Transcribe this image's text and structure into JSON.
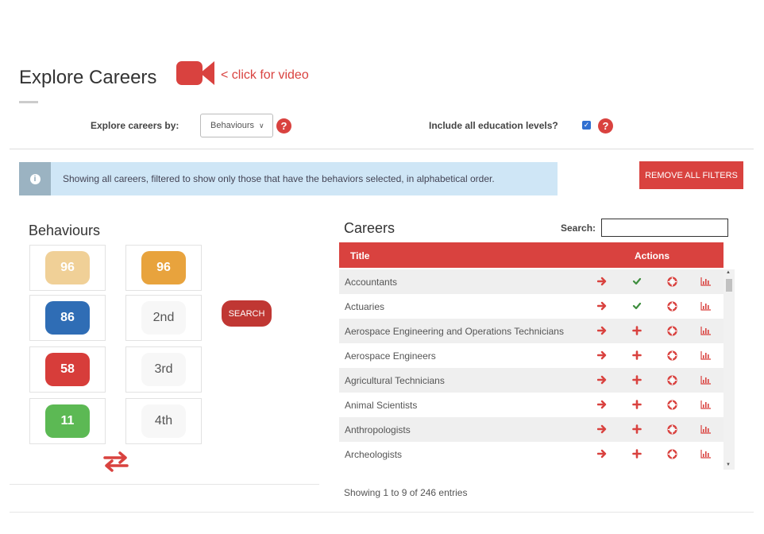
{
  "header": {
    "title": "Explore Careers",
    "video_link": "< click for video"
  },
  "controls": {
    "explore_by_label": "Explore careers by:",
    "explore_by_value": "Behaviours",
    "education_label": "Include all education levels?",
    "education_checked": true
  },
  "info": {
    "message": "Showing all careers, filtered to show only those that have the behaviors selected, in alphabetical order.",
    "remove_filters": "REMOVE ALL FILTERS"
  },
  "behaviours": {
    "heading": "Behaviours",
    "scores": [
      {
        "value": "96",
        "color": "#f0d097",
        "text_color": "#ffffff"
      },
      {
        "value": "86",
        "color": "#2f6db5",
        "text_color": "#ffffff"
      },
      {
        "value": "58",
        "color": "#d73d3a",
        "text_color": "#ffffff"
      },
      {
        "value": "11",
        "color": "#5cb954",
        "text_color": "#ffffff"
      }
    ],
    "ranks": [
      {
        "value": "96",
        "color": "#e8a33d",
        "text_color": "#ffffff"
      },
      {
        "value": "2nd"
      },
      {
        "value": "3rd"
      },
      {
        "value": "4th"
      }
    ],
    "search_button": "SEARCH"
  },
  "careers": {
    "heading": "Careers",
    "search_label": "Search:",
    "search_value": "",
    "columns": {
      "title": "Title",
      "actions": "Actions"
    },
    "rows": [
      {
        "title": "Accountants",
        "second": "check"
      },
      {
        "title": "Actuaries",
        "second": "check"
      },
      {
        "title": "Aerospace Engineering and Operations Technicians",
        "second": "plus"
      },
      {
        "title": "Aerospace Engineers",
        "second": "plus"
      },
      {
        "title": "Agricultural Technicians",
        "second": "plus"
      },
      {
        "title": "Animal Scientists",
        "second": "plus"
      },
      {
        "title": "Anthropologists",
        "second": "plus"
      },
      {
        "title": "Archeologists",
        "second": "plus"
      }
    ],
    "entries_info": "Showing 1 to 9 of 246 entries"
  },
  "colors": {
    "accent": "#d9423f",
    "check": "#3e8e3e",
    "info_bg": "#cfe6f6",
    "row_alt": "#efefef"
  }
}
